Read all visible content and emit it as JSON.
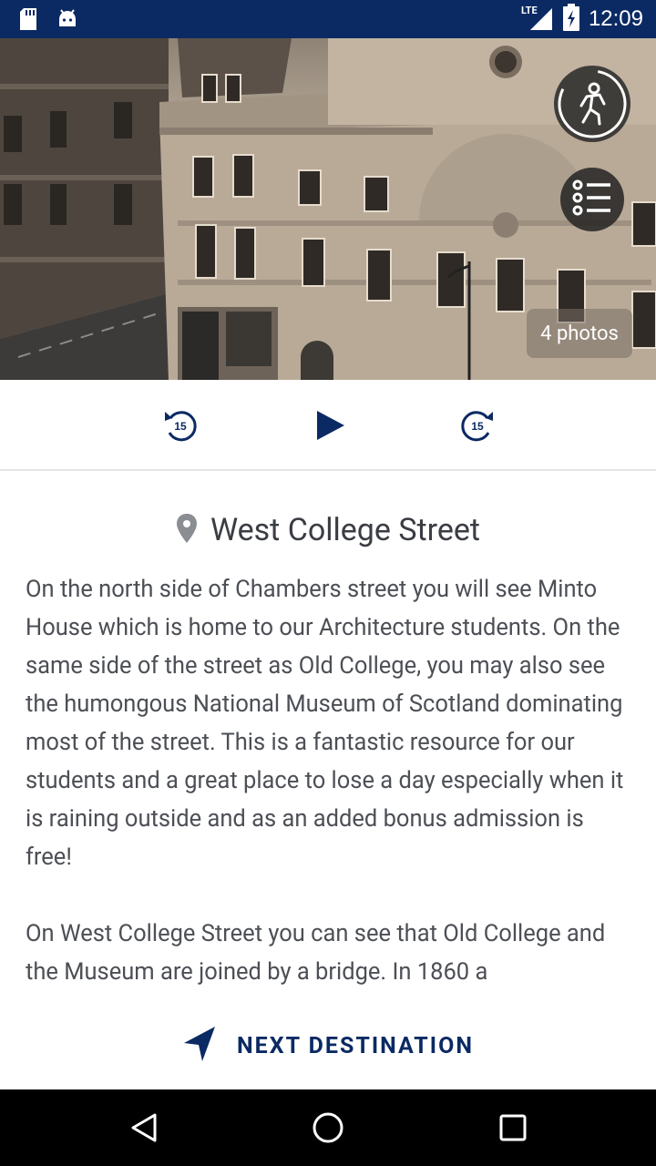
{
  "status_bar": {
    "time": "12:09",
    "network": "LTE",
    "icons": [
      "sd-card-icon",
      "android-icon",
      "signal-icon",
      "battery-charging-icon"
    ]
  },
  "hero": {
    "photos_badge": "4 photos",
    "icons": [
      "walker-icon",
      "list-icon"
    ]
  },
  "audio": {
    "rewind_seconds": "15",
    "forward_seconds": "15",
    "icons": [
      "rewind-15-icon",
      "play-icon",
      "forward-15-icon"
    ]
  },
  "location": {
    "title": "West College Street",
    "icon": "map-pin-icon",
    "paragraphs": [
      "On the north side of Chambers street you will see Minto House which is home to our Architecture students. On the same side of the street as Old College, you may also see the humongous National Museum of Scotland dominating most of the street. This is a fantastic resource for our students and a great place to lose a day especially when it is raining outside and as an added bonus admission is free!",
      "On West College Street you can see that Old College and the Museum are joined by a bridge. In 1860 a"
    ]
  },
  "next": {
    "label": "NEXT DESTINATION",
    "icon": "navigation-arrow-icon"
  },
  "nav": {
    "icons": [
      "back-icon",
      "home-icon",
      "recents-icon"
    ]
  },
  "colors": {
    "primary": "#0b2a63",
    "text": "#4c4f55",
    "title": "#3a3d44",
    "pin": "#8a8d92"
  }
}
